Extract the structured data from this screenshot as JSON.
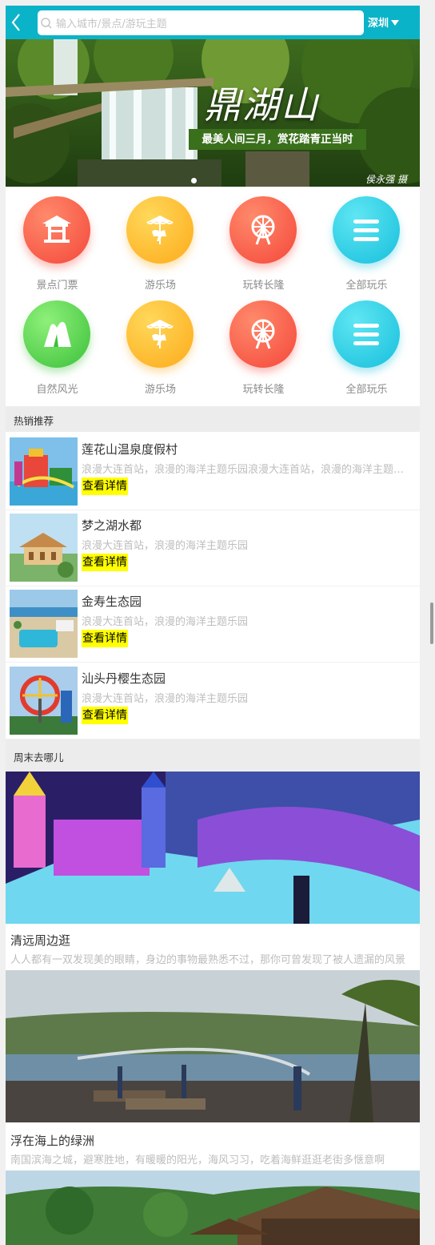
{
  "header": {
    "back_icon": "chevron-left-icon",
    "search_placeholder": "输入城市/景点/游玩主题",
    "city": "深圳"
  },
  "banner": {
    "title": "鼎湖山",
    "tagline": "最美人间三月，赏花踏青正当时",
    "credit": "侯永强 摄",
    "slide_count": 1,
    "active_slide": 1
  },
  "categories": [
    {
      "label": "景点门票",
      "icon": "pavilion-icon",
      "color": "red"
    },
    {
      "label": "游乐场",
      "icon": "carousel-icon",
      "color": "yellow"
    },
    {
      "label": "玩转长隆",
      "icon": "ferris-wheel-icon",
      "color": "red"
    },
    {
      "label": "全部玩乐",
      "icon": "menu-icon",
      "color": "cyan"
    },
    {
      "label": "自然风光",
      "icon": "mountain-icon",
      "color": "green"
    },
    {
      "label": "游乐场",
      "icon": "carousel-icon",
      "color": "yellow"
    },
    {
      "label": "玩转长隆",
      "icon": "ferris-wheel-icon",
      "color": "red"
    },
    {
      "label": "全部玩乐",
      "icon": "menu-icon",
      "color": "cyan"
    }
  ],
  "hot": {
    "title": "热销推荐",
    "items": [
      {
        "name": "莲花山温泉度假村",
        "desc": "浪漫大连首站，浪漫的海洋主题乐园浪漫大连首站，浪漫的海洋主题乐园",
        "button": "查看详情"
      },
      {
        "name": "梦之湖水都",
        "desc": "浪漫大连首站，浪漫的海洋主题乐园",
        "button": "查看详情"
      },
      {
        "name": "金寿生态园",
        "desc": "浪漫大连首站，浪漫的海洋主题乐园",
        "button": "查看详情"
      },
      {
        "name": "汕头丹樱生态园",
        "desc": "浪漫大连首站，浪漫的海洋主题乐园",
        "button": "查看详情"
      }
    ]
  },
  "weekend": {
    "title": "周末去哪儿",
    "items": [
      {
        "name": "清远周边逛",
        "desc": "人人都有一双发现美的眼睛，身边的事物最熟悉不过，那你可曾发现了被人遗漏的风景"
      },
      {
        "name": "浮在海上的绿洲",
        "desc": "南国滨海之城，避寒胜地，有暖暖的阳光，海风习习，吃着海鲜逛逛老街多惬意啊"
      }
    ]
  }
}
